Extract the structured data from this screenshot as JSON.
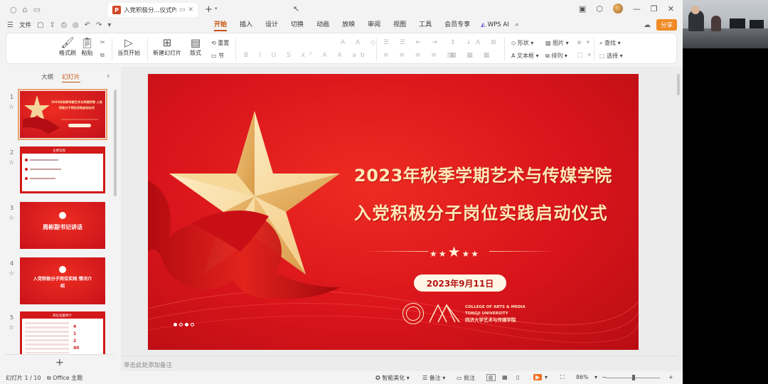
{
  "app": {
    "tab_title": "入党积极分...仪式PPT",
    "file_menu": "文件",
    "tabs": [
      "开始",
      "插入",
      "设计",
      "切换",
      "动画",
      "放映",
      "审阅",
      "视图",
      "工具",
      "会员专享"
    ],
    "active_tab": "开始",
    "wps_ai": "WPS AI",
    "share": "分享"
  },
  "ribbon": {
    "format_painter": "格式刷",
    "paste": "粘贴",
    "play_from_current": "当页开始",
    "new_slide": "新建幻灯片",
    "layout": "版式",
    "section": "节",
    "reset": "重置",
    "shape": "形状",
    "picture": "图片",
    "textbox": "文本框",
    "arrange": "排列",
    "find": "查找",
    "select": "选择"
  },
  "left_panel": {
    "outline_tab": "大纲",
    "slides_tab": "幻灯片",
    "thumbnails": [
      {
        "num": "1",
        "text": "2023年秋季学期艺术与传媒学院 入党积极分子岗位实践启动仪式"
      },
      {
        "num": "2",
        "text": "主要议程"
      },
      {
        "num": "3",
        "text": "周彬副书记讲话"
      },
      {
        "num": "4",
        "text": "入党积极分子岗位实践 情况介绍"
      },
      {
        "num": "5",
        "text": "岗位设置简介"
      }
    ],
    "thumb5_stats": [
      "4",
      "1",
      "2",
      "40"
    ]
  },
  "slide": {
    "title_line1": "2023年秋季学期艺术与传媒学院",
    "title_line2": "入党积极分子岗位实践启动仪式",
    "date": "2023年9月11日",
    "college_en1": "COLLEGE OF ARTS & MEDIA",
    "college_en2": "TONGJI UNIVERSITY",
    "college_cn": "同济大学艺术与传媒学院"
  },
  "notes_placeholder": "单击此处添加备注",
  "status": {
    "slide_count": "幻灯片 1 / 10",
    "theme": "Office 主题",
    "smart_beautify": "智能美化",
    "notes": "备注",
    "comments": "批注",
    "zoom": "86%"
  },
  "colors": {
    "accent": "#c8510b",
    "slide_red": "#d9141b",
    "title_gold": "#ffe9b8"
  }
}
